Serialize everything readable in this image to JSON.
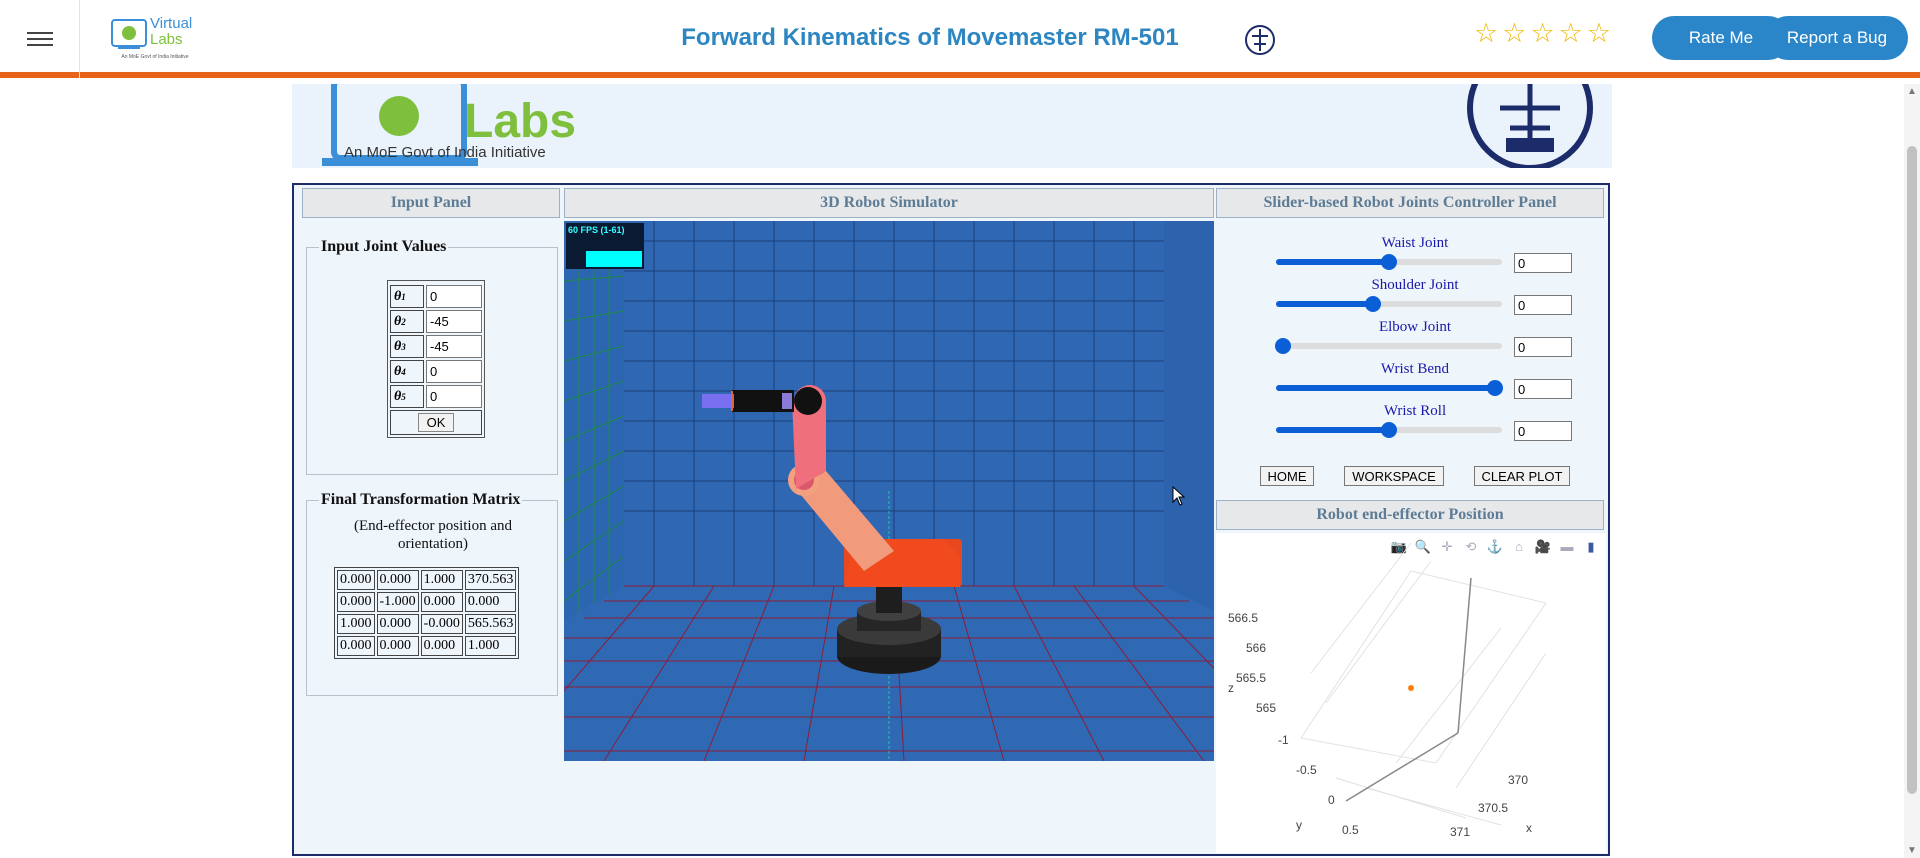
{
  "header": {
    "title": "Forward Kinematics of Movemaster RM-501",
    "logo_text_1": "Virtual",
    "logo_text_2": "Labs",
    "logo_sub": "An MoE Govt of India Initiative",
    "rate_label": "Rate Me",
    "bug_label": "Report a Bug",
    "stars": [
      "☆",
      "☆",
      "☆",
      "☆",
      "☆"
    ]
  },
  "banner": {
    "labs_text": "Labs",
    "tagline": "An MoE Govt of India Initiative"
  },
  "panels": {
    "input_title": "Input Panel",
    "sim_title": "3D Robot Simulator",
    "slider_title": "Slider-based Robot Joints Controller Panel",
    "plot_title": "Robot end-effector Position"
  },
  "joints_fieldset": {
    "legend": "Input Joint Values",
    "rows": [
      {
        "label": "θ",
        "sub": "1",
        "value": "0"
      },
      {
        "label": "θ",
        "sub": "2",
        "value": "-45"
      },
      {
        "label": "θ",
        "sub": "3",
        "value": "-45"
      },
      {
        "label": "θ",
        "sub": "4",
        "value": "0"
      },
      {
        "label": "θ",
        "sub": "5",
        "value": "0"
      }
    ],
    "ok_label": "OK"
  },
  "matrix_fieldset": {
    "legend": "Final Transformation Matrix",
    "caption_1": "(End-effector position and",
    "caption_2": "orientation)",
    "rows": [
      [
        "0.000",
        "0.000",
        "1.000",
        "370.563"
      ],
      [
        "0.000",
        "-1.000",
        "0.000",
        "0.000"
      ],
      [
        "1.000",
        "0.000",
        "-0.000",
        "565.563"
      ],
      [
        "0.000",
        "0.000",
        "0.000",
        "1.000"
      ]
    ]
  },
  "simulator": {
    "fps_text": "60 FPS (1-61)"
  },
  "sliders": [
    {
      "label": "Waist Joint",
      "value": "0",
      "fraction": 0.5
    },
    {
      "label": "Shoulder Joint",
      "value": "0",
      "fraction": 0.43
    },
    {
      "label": "Elbow Joint",
      "value": "0",
      "fraction": 0.03
    },
    {
      "label": "Wrist Bend",
      "value": "0",
      "fraction": 0.97
    },
    {
      "label": "Wrist Roll",
      "value": "0",
      "fraction": 0.5
    }
  ],
  "buttons": {
    "home": "HOME",
    "workspace": "WORKSPACE",
    "clear": "CLEAR PLOT"
  },
  "plot": {
    "toolbar_icons": [
      "camera-icon",
      "zoom-icon",
      "pan-icon",
      "orbit-icon",
      "turntable-icon",
      "home-icon",
      "camera-view-icon",
      "hover-icon",
      "plotly-logo-icon"
    ],
    "toolbar_glyphs": [
      "📷",
      "🔍",
      "✛",
      "⟲",
      "⚓",
      "⌂",
      "🎥",
      "▬",
      "▮"
    ],
    "z_ticks": [
      "566.5",
      "566",
      "565.5",
      "565"
    ],
    "y_ticks": [
      "-1",
      "-0.5",
      "0",
      "0.5"
    ],
    "x_ticks": [
      "370",
      "370.5",
      "371"
    ],
    "x_label": "x",
    "y_label": "y",
    "z_label": "z",
    "point_color": "#ff7f0e"
  },
  "colors": {
    "accent": "#2a86c9",
    "orange_bar": "#e8631a",
    "sim_bg": "#2f67b3"
  }
}
